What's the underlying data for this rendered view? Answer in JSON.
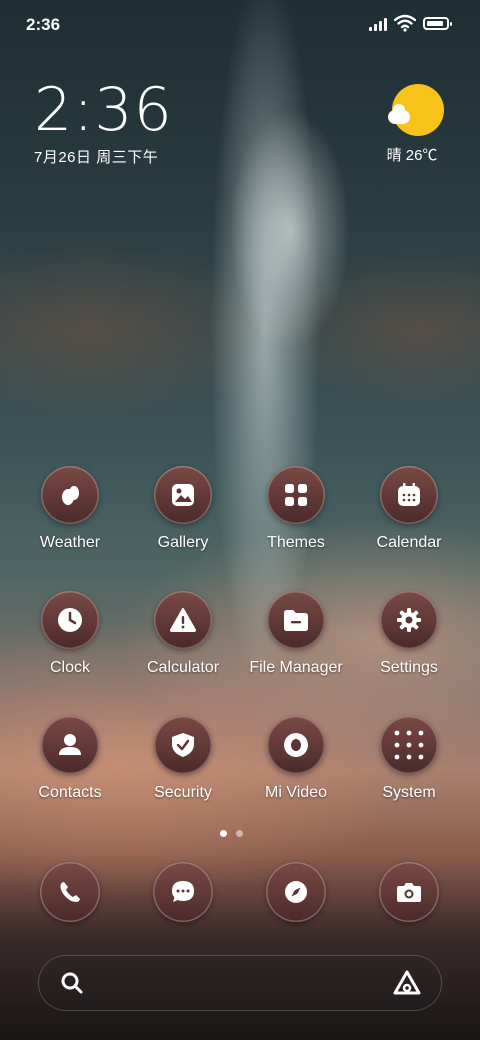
{
  "status_bar": {
    "time": "2:36",
    "battery_level": 0.9
  },
  "clock_widget": {
    "time": "2:36",
    "date": "7月26日 周三下午"
  },
  "weather_widget": {
    "condition_temp": "晴 26℃",
    "icon": "sun-cloud-icon"
  },
  "apps": [
    {
      "label": "Weather",
      "icon": "weather-icon"
    },
    {
      "label": "Gallery",
      "icon": "gallery-icon"
    },
    {
      "label": "Themes",
      "icon": "themes-icon"
    },
    {
      "label": "Calendar",
      "icon": "calendar-icon"
    },
    {
      "label": "Clock",
      "icon": "clock-icon"
    },
    {
      "label": "Calculator",
      "icon": "warning-icon"
    },
    {
      "label": "File Manager",
      "icon": "folder-icon"
    },
    {
      "label": "Settings",
      "icon": "gear-icon"
    },
    {
      "label": "Contacts",
      "icon": "person-icon"
    },
    {
      "label": "Security",
      "icon": "shield-check-icon"
    },
    {
      "label": "Mi Video",
      "icon": "video-icon"
    },
    {
      "label": "System",
      "icon": "folder-grid-icon"
    }
  ],
  "page_indicator": {
    "pages": 2,
    "current": 1
  },
  "dock": [
    {
      "icon": "phone-icon"
    },
    {
      "icon": "message-icon"
    },
    {
      "icon": "compass-icon"
    },
    {
      "icon": "camera-icon"
    }
  ],
  "search_bar": {
    "left_icon": "search-icon",
    "right_icon": "assistant-icon"
  },
  "colors": {
    "icon_bg_top": "#7a4a45",
    "icon_bg_bottom": "#4a2a2a",
    "sun": "#f7c21a"
  }
}
